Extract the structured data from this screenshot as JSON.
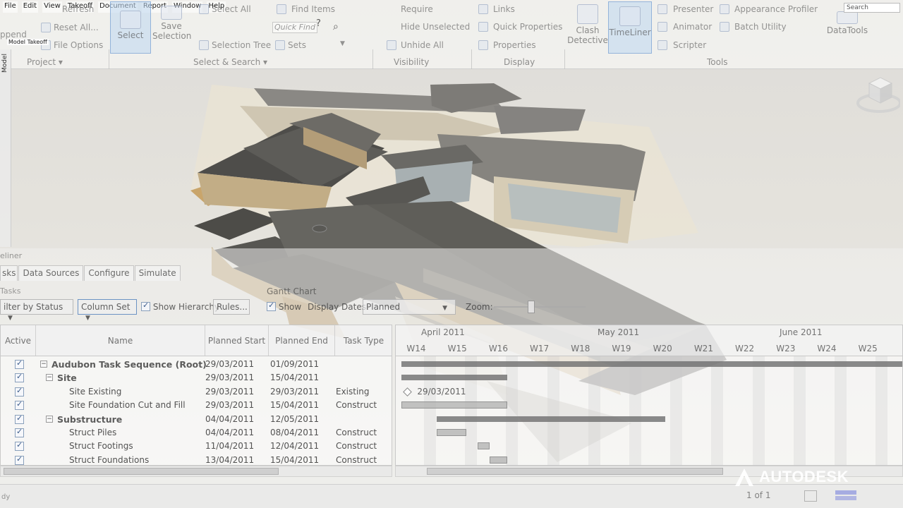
{
  "menu": [
    "File",
    "Edit",
    "View",
    "Takeoff",
    "Document",
    "Report",
    "Window",
    "Help"
  ],
  "ribbon": {
    "project": {
      "append": "ppend",
      "refresh": "Refresh",
      "reset_all": "Reset All...",
      "file_options": "File Options",
      "model_takeoff": "Model Takeoff"
    },
    "select_search": {
      "select": "Select",
      "save_selection": "Save\nSelection",
      "select_all": "Select All",
      "selection_tree": "Selection Tree",
      "find_items": "Find Items",
      "quick_find": "Quick Find",
      "sets": "Sets"
    },
    "visibility": {
      "require": "Require",
      "hide_unselected": "Hide Unselected",
      "unhide_all": "Unhide All"
    },
    "display": {
      "links": "Links",
      "quick_properties": "Quick Properties",
      "properties": "Properties"
    },
    "tools": {
      "clash_detective": "Clash\nDetective",
      "timeliner": "TimeLiner",
      "presenter": "Presenter",
      "animator": "Animator",
      "scripter": "Scripter",
      "appearance_profiler": "Appearance Profiler",
      "batch_utility": "Batch Utility"
    },
    "datatools": "DataTools",
    "search_placeholder": "Search",
    "panels": {
      "project": "Project",
      "select_search": "Select & Search",
      "visibility": "Visibility",
      "display": "Display",
      "tools": "Tools"
    }
  },
  "left_strip_label": "Model",
  "timeliner": {
    "title": "eliner",
    "tabs": [
      "sks",
      "Data Sources",
      "Configure",
      "Simulate"
    ],
    "tasks_label": "Tasks",
    "toolbar": {
      "filter_by_status": "ilter by Status",
      "column_set": "Column Set",
      "show_hierarchy": "Show Hierarchy",
      "rules": "Rules...",
      "gantt_chart": "Gantt Chart",
      "show": "Show",
      "display_dates": "Display Dates:",
      "display_dates_value": "Planned",
      "zoom": "Zoom:"
    },
    "columns": [
      "Active",
      "Name",
      "Planned Start",
      "Planned End",
      "Task Type"
    ],
    "rows": [
      {
        "name": "Audubon Task Sequence (Root)",
        "start": "29/03/2011",
        "end": "01/09/2011",
        "type": "",
        "summary": true,
        "level": 0
      },
      {
        "name": "Site",
        "start": "29/03/2011",
        "end": "15/04/2011",
        "type": "",
        "summary": true,
        "level": 1
      },
      {
        "name": "Site Existing",
        "start": "29/03/2011",
        "end": "29/03/2011",
        "type": "Existing",
        "summary": false,
        "level": 2
      },
      {
        "name": "Site Foundation Cut and Fill",
        "start": "29/03/2011",
        "end": "15/04/2011",
        "type": "Construct",
        "summary": false,
        "level": 2
      },
      {
        "name": "Substructure",
        "start": "04/04/2011",
        "end": "12/05/2011",
        "type": "",
        "summary": true,
        "level": 1
      },
      {
        "name": "Struct Piles",
        "start": "04/04/2011",
        "end": "08/04/2011",
        "type": "Construct",
        "summary": false,
        "level": 2
      },
      {
        "name": "Struct Footings",
        "start": "11/04/2011",
        "end": "12/04/2011",
        "type": "Construct",
        "summary": false,
        "level": 2
      },
      {
        "name": "Struct Foundations",
        "start": "13/04/2011",
        "end": "15/04/2011",
        "type": "Construct",
        "summary": false,
        "level": 2
      }
    ],
    "gantt": {
      "months": [
        {
          "label": "April 2011"
        },
        {
          "label": "May 2011"
        },
        {
          "label": "June 2011"
        }
      ],
      "weeks": [
        "W14",
        "W15",
        "W16",
        "W17",
        "W18",
        "W19",
        "W20",
        "W21",
        "W22",
        "W23",
        "W24",
        "W25"
      ],
      "milestone_label": "29/03/2011"
    }
  },
  "status": {
    "ready": "dy",
    "page": "1 of 1"
  },
  "watermark": "AUTODESK",
  "colors": {
    "highlight_button": "#bed7f0",
    "roof": "#5e5d58",
    "wall": "#b19d7a",
    "glass": "#9aa6ac",
    "ground": "#e3dbc8"
  }
}
